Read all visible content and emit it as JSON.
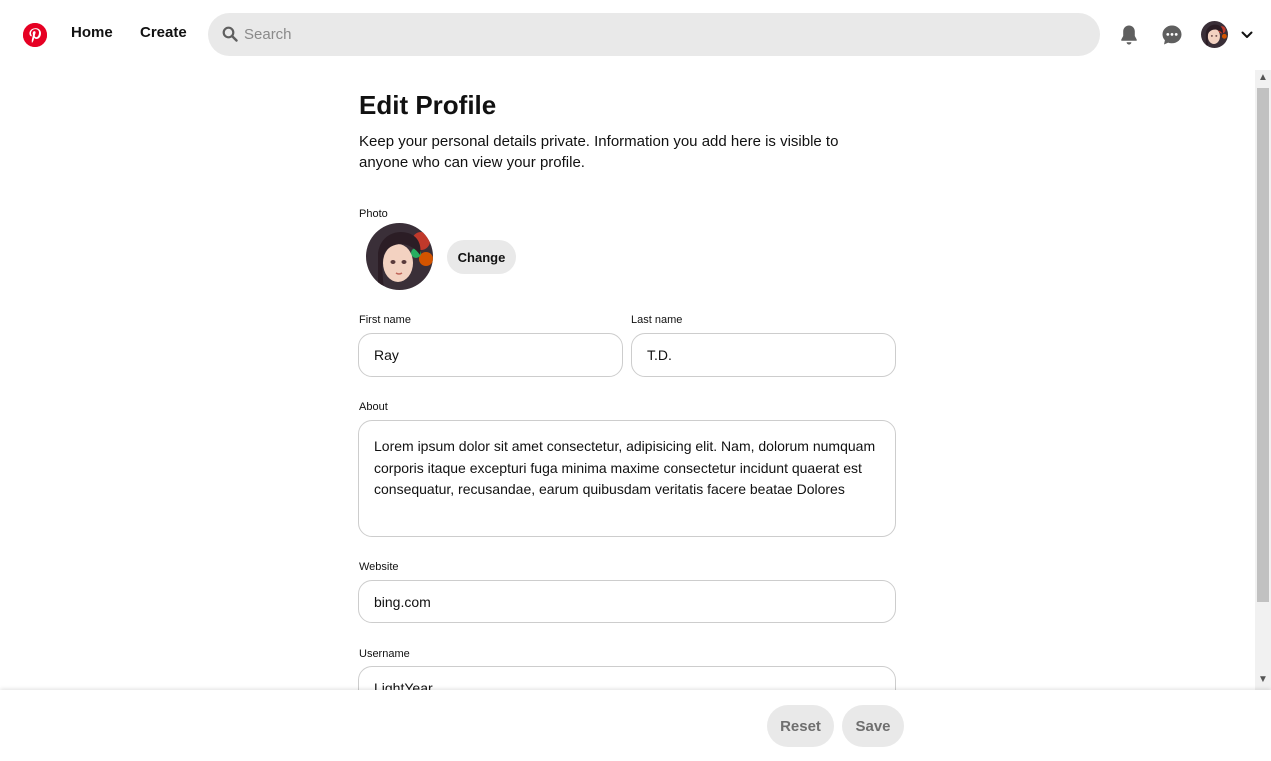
{
  "header": {
    "nav": {
      "home": "Home",
      "create": "Create"
    },
    "search": {
      "placeholder": "Search",
      "value": ""
    },
    "icons": [
      "pinterest-logo-icon",
      "search-icon",
      "bell-icon",
      "chat-icon",
      "chevron-down-icon"
    ]
  },
  "main": {
    "title": "Edit Profile",
    "description": "Keep your personal details private. Information you add here is visible to anyone who can view your profile.",
    "photo": {
      "label": "Photo",
      "change_label": "Change"
    },
    "first_name": {
      "label": "First name",
      "value": "Ray"
    },
    "last_name": {
      "label": "Last name",
      "value": "T.D."
    },
    "about": {
      "label": "About",
      "value": "Lorem ipsum dolor sit amet consectetur, adipisicing elit. Nam, dolorum numquam corporis itaque excepturi fuga minima maxime consectetur incidunt quaerat est consequatur, recusandae, earum quibusdam veritatis facere beatae Dolores"
    },
    "website": {
      "label": "Website",
      "value": "bing.com"
    },
    "username": {
      "label": "Username",
      "value": "LightYear"
    }
  },
  "footer": {
    "reset_label": "Reset",
    "save_label": "Save"
  },
  "colors": {
    "brand": "#e60023",
    "field_bg": "#e9e9e9",
    "border": "#cdcdcd"
  }
}
